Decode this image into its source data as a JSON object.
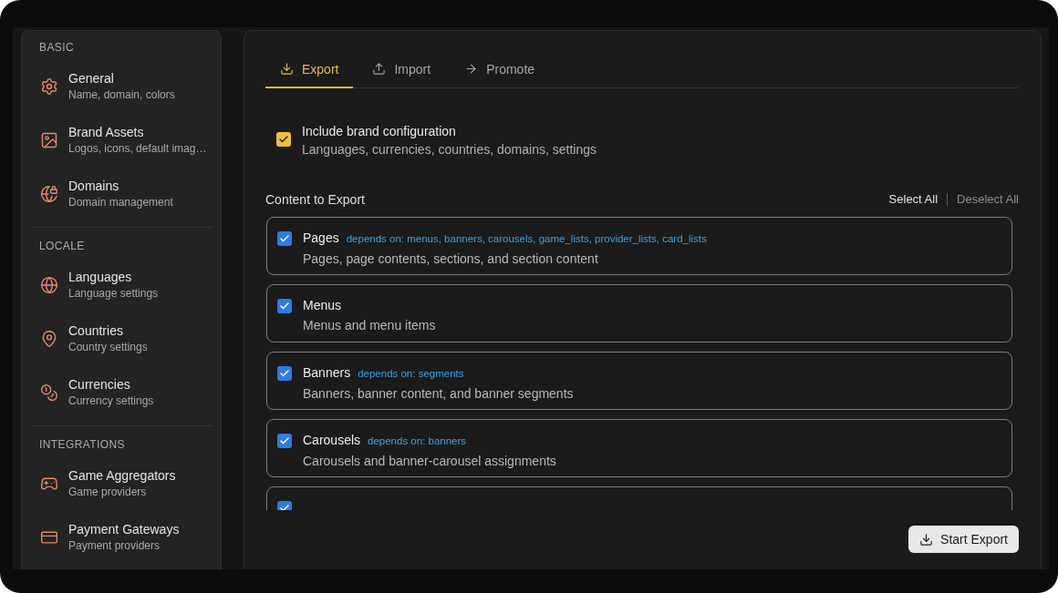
{
  "sidebar": {
    "sections": [
      {
        "heading": "BASIC",
        "items": [
          {
            "title": "General",
            "subtitle": "Name, domain, colors"
          },
          {
            "title": "Brand Assets",
            "subtitle": "Logos, icons, default imag…"
          },
          {
            "title": "Domains",
            "subtitle": "Domain management"
          }
        ]
      },
      {
        "heading": "LOCALE",
        "items": [
          {
            "title": "Languages",
            "subtitle": "Language settings"
          },
          {
            "title": "Countries",
            "subtitle": "Country settings"
          },
          {
            "title": "Currencies",
            "subtitle": "Currency settings"
          }
        ]
      },
      {
        "heading": "INTEGRATIONS",
        "items": [
          {
            "title": "Game Aggregators",
            "subtitle": "Game providers"
          },
          {
            "title": "Payment Gateways",
            "subtitle": "Payment providers"
          }
        ]
      }
    ]
  },
  "tabs": [
    {
      "label": "Export",
      "selected": true
    },
    {
      "label": "Import",
      "selected": false
    },
    {
      "label": "Promote",
      "selected": false
    }
  ],
  "include_brand": {
    "title": "Include brand configuration",
    "description": "Languages, currencies, countries, domains, settings",
    "checked": true
  },
  "content": {
    "heading": "Content to Export",
    "select_all": "Select All",
    "deselect_all": "Deselect All",
    "items": [
      {
        "name": "Pages",
        "depends_on": "depends on: menus, banners, carousels, game_lists, provider_lists, card_lists",
        "description": "Pages, page contents, sections, and section content",
        "checked": true
      },
      {
        "name": "Menus",
        "description": "Menus and menu items",
        "checked": true
      },
      {
        "name": "Banners",
        "depends_on": "depends on: segments",
        "description": "Banners, banner content, and banner segments",
        "checked": true
      },
      {
        "name": "Carousels",
        "depends_on": "depends on: banners",
        "description": "Carousels and banner-carousel assignments",
        "checked": true
      },
      {
        "checked": true
      }
    ]
  },
  "start_button": "Start Export"
}
